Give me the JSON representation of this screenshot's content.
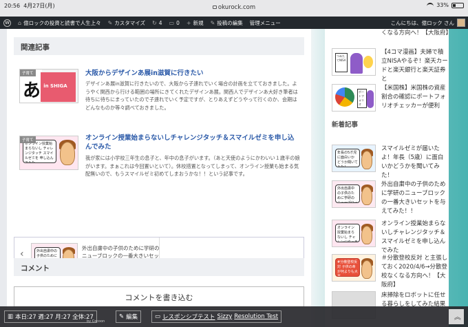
{
  "statusbar": {
    "time": "20:56",
    "date": "4月27日(月)",
    "url": "okurock.com",
    "battery": "33%"
  },
  "adminbar": {
    "site_name": "億ロックの投資と読書で人生上々",
    "customize": "カスタマイズ",
    "updates_count": "4",
    "comments_count": "0",
    "new": "新規",
    "edit_post": "投稿の編集",
    "admin_menu": "管理メニュー",
    "greeting": "こんにちは、億ロック さん"
  },
  "related": {
    "heading": "関連記事",
    "items": [
      {
        "category": "子育て",
        "title": "大阪からデザインあ展in滋賀に行きたい",
        "snippet": "デザインあ展in滋賀に行きたいので、大阪から子連れでいく場合の計画を立てておきました。ようやく関西から行ける範囲の場所にきてくれたデザインあ展。関西人でデザインあ大好き筆者は待ちに待ちにまっていたので子連れでいく予定ですが、とりあえずどうやって行くのか、会期はどんなものか等々調べておきました。",
        "thumb_text": "in SHIGA"
      },
      {
        "category": "子育て",
        "title": "オンライン授業始まらないしチャレンジタッチ＆スマイルゼミを申し込んでみた",
        "snippet": "我が家には小学校三年生の息子と、年中の息子がいます。（あと天使のようにかわいい１歳半の娘がいます。まぁこれは今回置いといて）。休校措置となってしまって、オンライン授業も始まる気配無いので、もうスマイルゼミ初めてしまおうかな！！という記事です。",
        "thumb_text": "オンライン授業始まらないし チャレンジタッチ スマイルゼミを 申し込んでみた"
      }
    ]
  },
  "postnav": {
    "prev_title": "外出自粛中の子供のために学研のニューブロックの一番大きいセットを与えてみた！！",
    "thumb_text": "外出自粛中の子供のために学研のニューブロックの一番大きいセットを与えてみた！"
  },
  "comments": {
    "heading": "コメント",
    "write_button": "コメントを書き込む"
  },
  "sidebar": {
    "popular": [
      {
        "title": "くなる方向へ！【大阪府】",
        "thumb_text": ""
      },
      {
        "title": "【4コマ漫画】夫婦で積立NISAやるぞ！楽天カードと楽天銀行と楽天証券と",
        "thumb_text": "つみたてNISA"
      },
      {
        "title": "【米国株】米国株の資産割合の確認にポートフォリオチェッカーが便利",
        "thumb_text": "ポートフォリオ"
      }
    ],
    "new_heading": "新着記事",
    "new_items": [
      {
        "title": "スマイルゼミが届いたよ！年長（5歳）に面白いかどうかを聞いてみた！",
        "thumb_text": "年長の5才児に面白いかどうか聞いてみた！"
      },
      {
        "title": "外出自粛中の子供のために学研のニューブロックの一番大きいセットを与えてみた！！",
        "thumb_text": "外出自粛中の子供のために学研のニューブロックの一番大きいセットを与えてみた！"
      },
      {
        "title": "オンライン授業始まらないしチャレンジタッチ＆スマイルゼミを申し込んでみた",
        "thumb_text": "オンライン授業始まらないし チャレンジタッチ スマイルゼミを申し込んでみた"
      },
      {
        "title": "＃分散登校反対 と主張しておく2020/4/6→分散登校なくなる方向へ！【大阪府】",
        "thumb_text": "#分散登校反対 子供の命が何よりも大事"
      },
      {
        "title": "床掃除をロボットに任せる暮らしをしてみた結果",
        "thumb_text": ""
      }
    ]
  },
  "footer": {
    "stats": "本日:27 週:27 月:27 全体:27",
    "by": "by Cocoon",
    "edit": "編集",
    "responsive_test": "レスポンシブテスト",
    "sizzy": "Sizzy",
    "resolution_test": "Resolution Test",
    "gotop": "《"
  }
}
